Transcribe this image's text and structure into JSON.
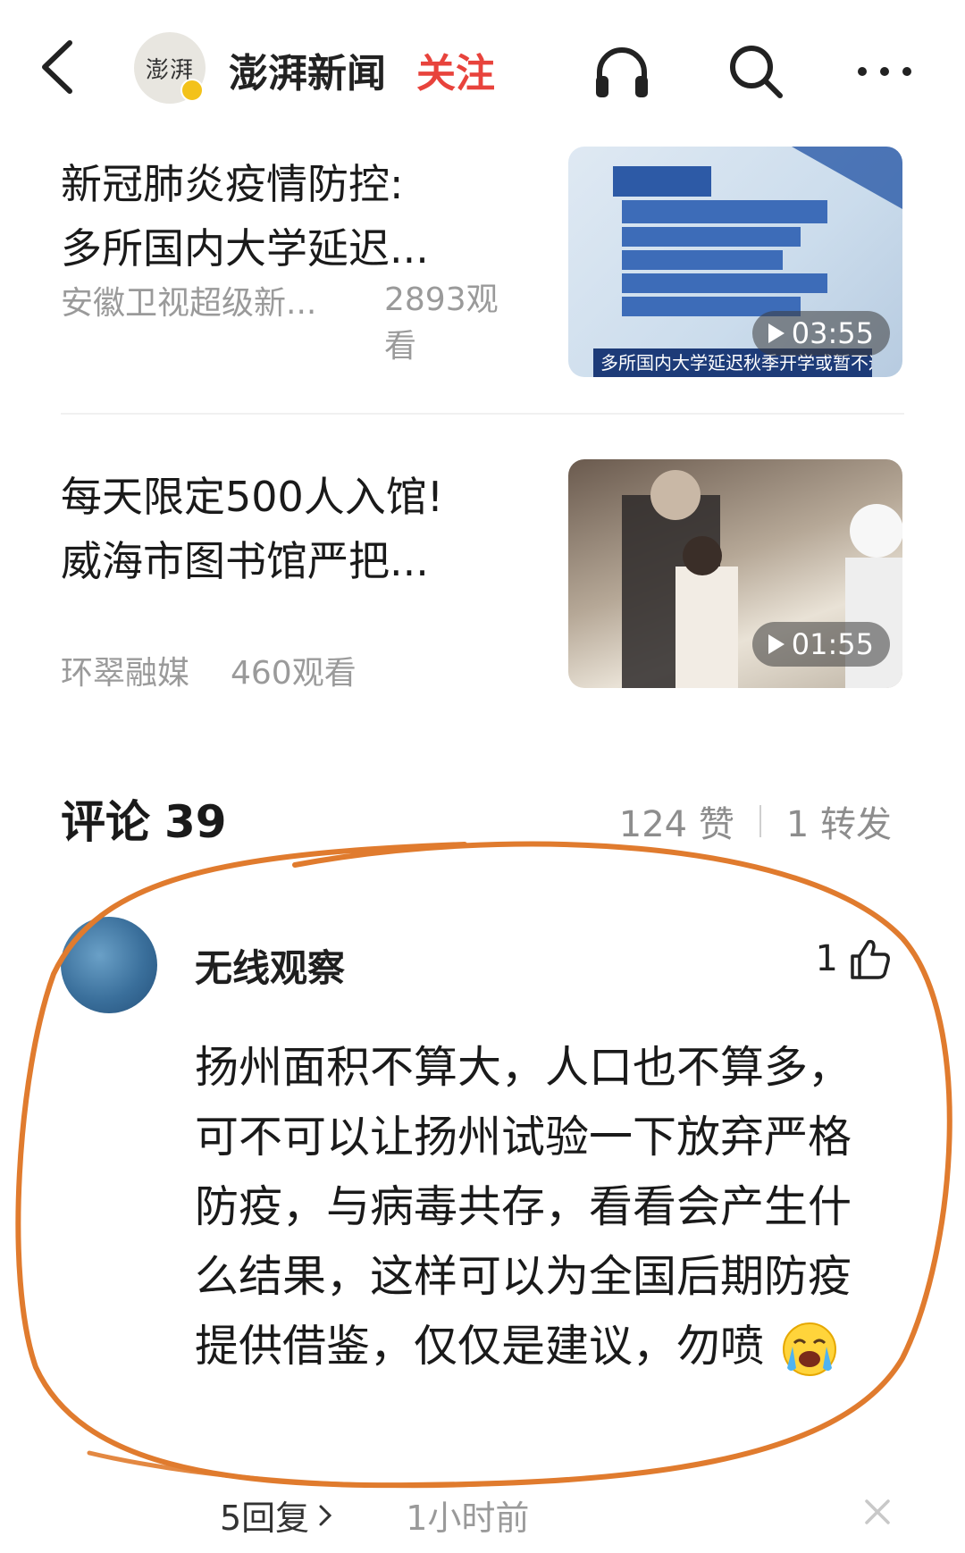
{
  "header": {
    "back_icon": "chevron-left-icon",
    "channel_avatar_text": "澎湃",
    "channel_name": "澎湃新闻",
    "follow_label": "关注",
    "icons": [
      "headphones-icon",
      "search-icon",
      "more-icon"
    ]
  },
  "related_news": [
    {
      "title_line1": "新冠肺炎疫情防控:",
      "title_line2": "多所国内大学延迟...",
      "source": "安徽卫视超级新...",
      "views": "2893观看",
      "duration": "03:55",
      "thumb_caption": "多所国内大学延迟秋季开学或暂不返校"
    },
    {
      "title_line1": "每天限定500人入馆!",
      "title_line2": "威海市图书馆严把...",
      "source": "环翠融媒",
      "views": "460观看",
      "duration": "01:55"
    }
  ],
  "comments_section": {
    "label": "评论",
    "count": "39",
    "likes": "124 赞",
    "shares": "1 转发"
  },
  "comment": {
    "username": "无线观察",
    "like_count": "1",
    "text": "扬州面积不算大，人口也不算多，可不可以让扬州试验一下放弃严格防疫，与病毒共存，看看会产生什么结果，这样可以为全国后期防疫提供借鉴，仅仅是建议，勿喷",
    "replies": "5回复",
    "time": "1小时前"
  },
  "colors": {
    "follow": "#e8433c",
    "annotation_ring": "#e07b2e",
    "secondary_text": "#9a9a9a"
  }
}
